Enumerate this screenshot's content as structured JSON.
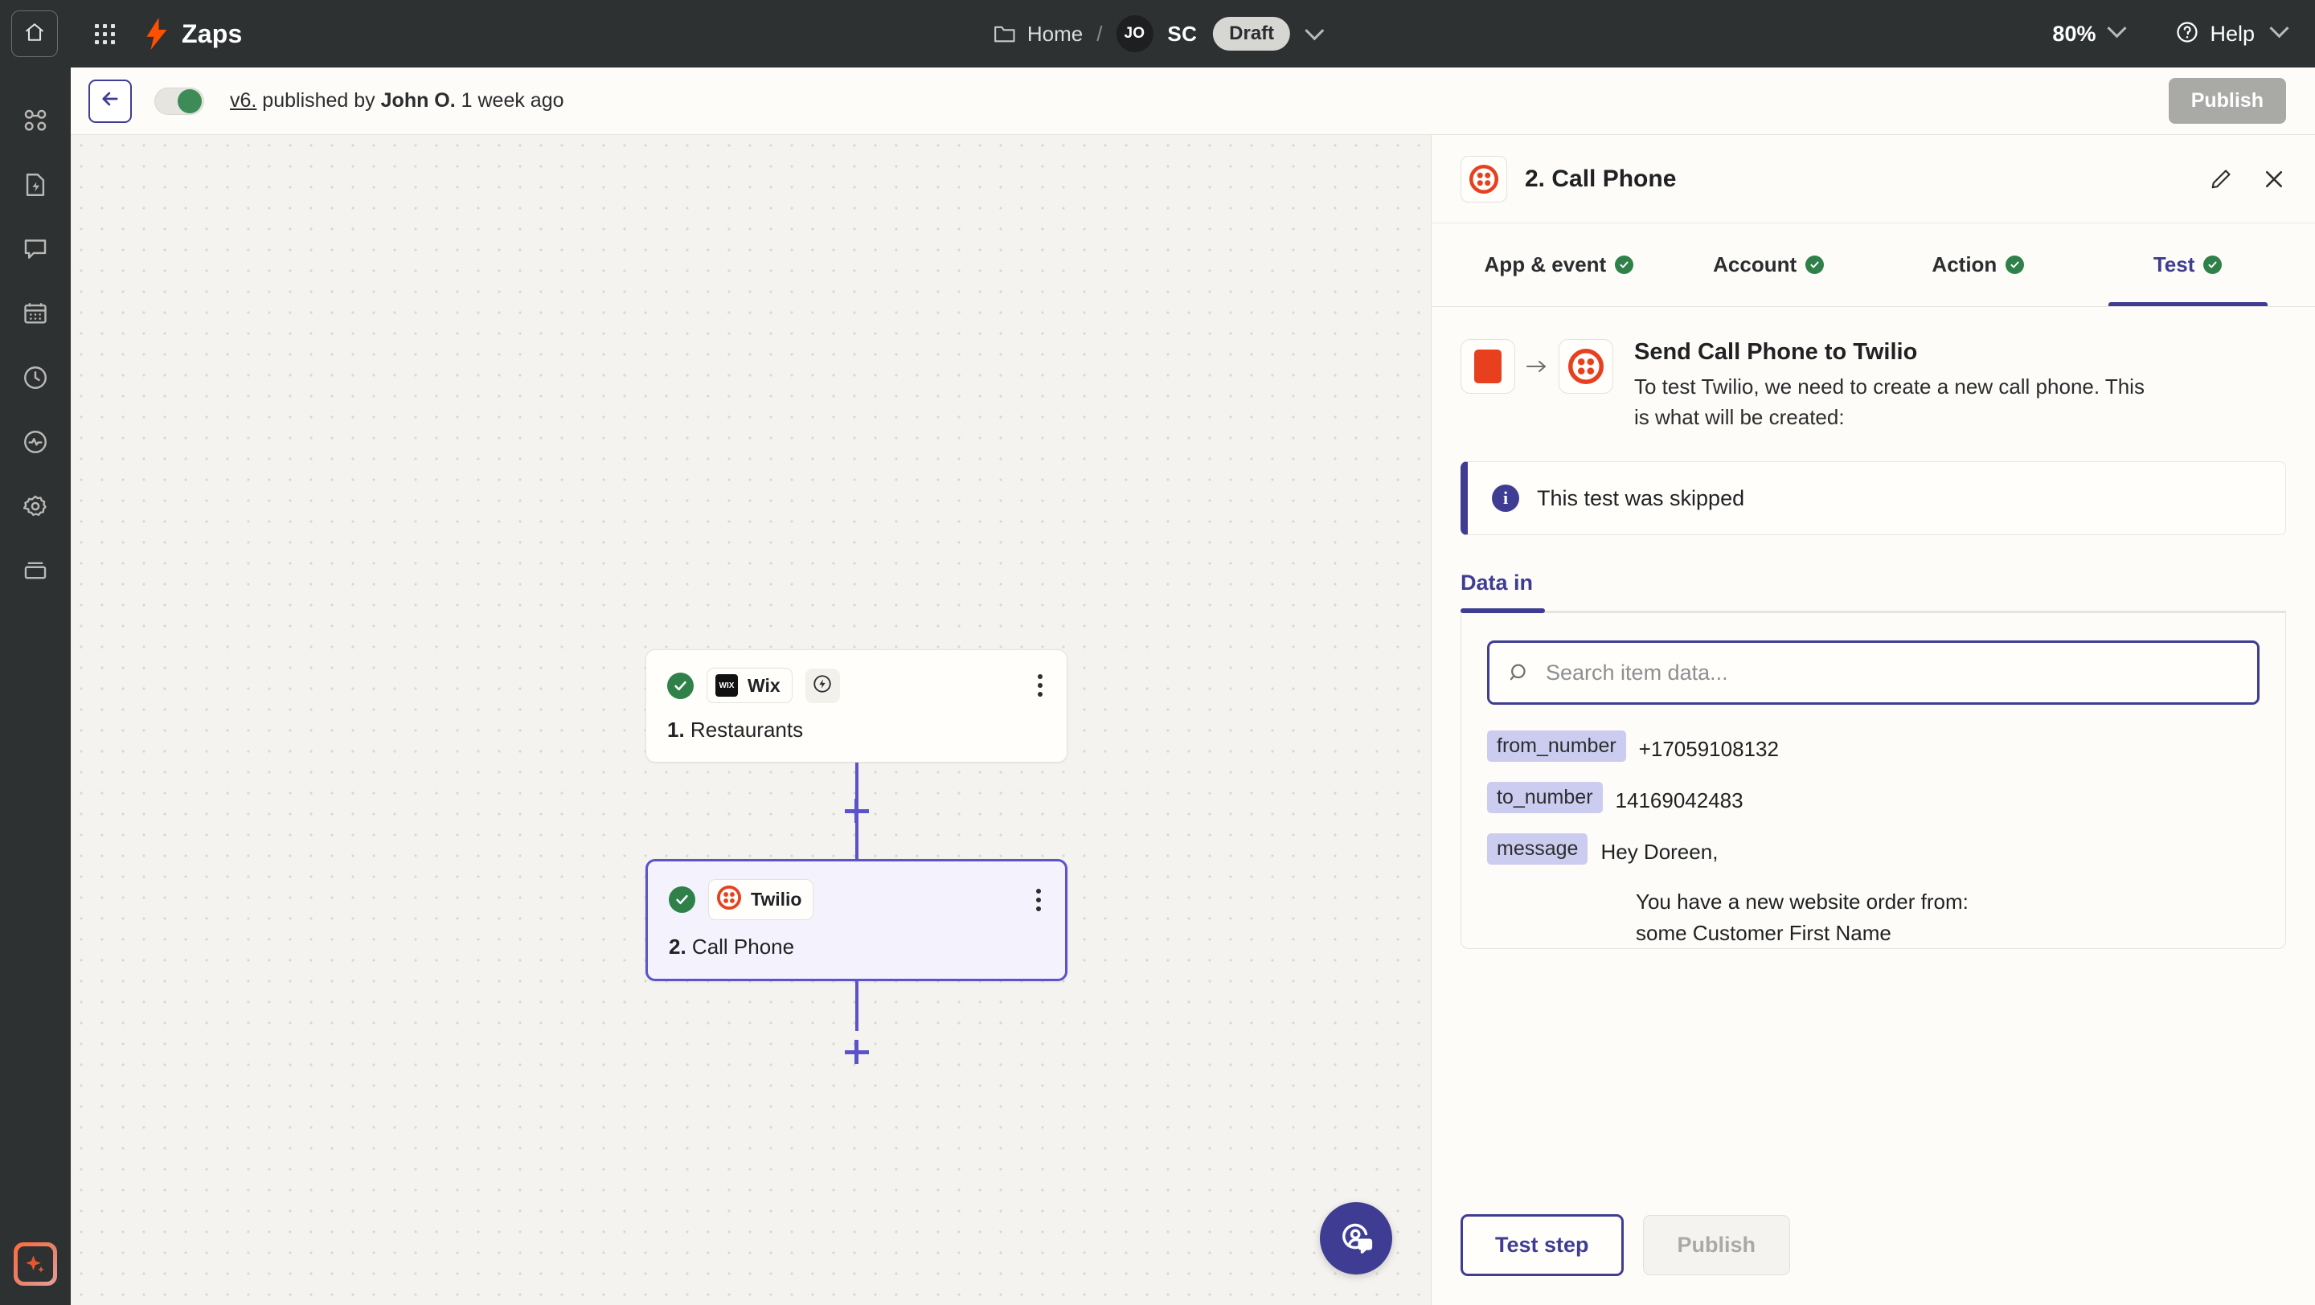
{
  "topbar": {
    "home_icon": "home-icon",
    "apps_icon": "apps-grid-icon",
    "brand_icon": "zapier-bolt-icon",
    "brand": "Zaps",
    "breadcrumb": {
      "folder_icon": "folder-icon",
      "home": "Home",
      "separator": "/",
      "avatar_initials": "JO",
      "account_initials": "SC",
      "status_badge": "Draft",
      "chevron_icon": "chevron-down-icon"
    },
    "zoom": {
      "value": "80%",
      "chevron_icon": "chevron-down-icon"
    },
    "help": {
      "icon": "help-circle-icon",
      "label": "Help",
      "chevron_icon": "chevron-down-icon"
    }
  },
  "leftnav": {
    "items": [
      {
        "name": "zaps-icon"
      },
      {
        "name": "zap-runs-icon"
      },
      {
        "name": "chat-icon"
      },
      {
        "name": "calendar-icon"
      },
      {
        "name": "history-clock-icon"
      },
      {
        "name": "activity-pulse-icon"
      },
      {
        "name": "settings-gear-icon"
      },
      {
        "name": "tables-icon"
      }
    ],
    "ai_button": "ai-sparkle-icon"
  },
  "subbar": {
    "back_icon": "arrow-left-icon",
    "enabled_toggle": "on",
    "version": "v6.",
    "published_by_prefix": " published by ",
    "author": "John O.",
    "time_ago": " 1 week ago",
    "publish_label": "Publish"
  },
  "canvas": {
    "nodes": [
      {
        "status_icon": "check-circle-icon",
        "app_icon": "wix-icon",
        "app": "Wix",
        "bolt_icon": "trigger-bolt-icon",
        "menu_icon": "kebab-menu-icon",
        "title_number": "1.",
        "title": " Restaurants",
        "selected": false
      },
      {
        "status_icon": "check-circle-icon",
        "app_icon": "twilio-icon",
        "app": "Twilio",
        "menu_icon": "kebab-menu-icon",
        "title_number": "2.",
        "title": " Call Phone",
        "selected": true
      }
    ],
    "add_step_icon": "plus-icon",
    "support_button": "support-chat-icon"
  },
  "panel": {
    "app_icon": "twilio-icon",
    "title": "2. Call Phone",
    "edit_icon": "pencil-icon",
    "close_icon": "close-x-icon",
    "tabs": [
      {
        "label": "App & event",
        "complete": true,
        "active": false
      },
      {
        "label": "Account",
        "complete": true,
        "active": false
      },
      {
        "label": "Action",
        "complete": true,
        "active": false
      },
      {
        "label": "Test",
        "complete": true,
        "active": true
      }
    ],
    "test": {
      "source_app_icon": "wix-square-icon",
      "arrow_icon": "arrow-right-icon",
      "target_app_icon": "twilio-icon",
      "heading": "Send Call Phone to Twilio",
      "description": "To test Twilio, we need to create a new call phone. This is what will be created:",
      "banner": {
        "icon": "info-icon",
        "text": "This test was skipped"
      },
      "subtabs": [
        {
          "label": "Data in",
          "active": true
        }
      ],
      "search": {
        "icon": "search-icon",
        "placeholder": "Search item data...",
        "value": ""
      },
      "fields": [
        {
          "key": "from_number",
          "value": "+17059108132"
        },
        {
          "key": "to_number",
          "value": "14169042483"
        },
        {
          "key": "message",
          "value": "Hey Doreen,"
        }
      ],
      "message_body_line1": "You have a new website order from:",
      "message_body_line2": "some Customer First Name"
    },
    "footer": {
      "test_label": "Test step",
      "publish_label": "Publish"
    }
  },
  "colors": {
    "accent_purple": "#3f3d93",
    "node_purple": "#5a53c9",
    "brand_orange": "#ff4f00",
    "success_green": "#2f8049",
    "topbar_dark": "#2e3132"
  }
}
